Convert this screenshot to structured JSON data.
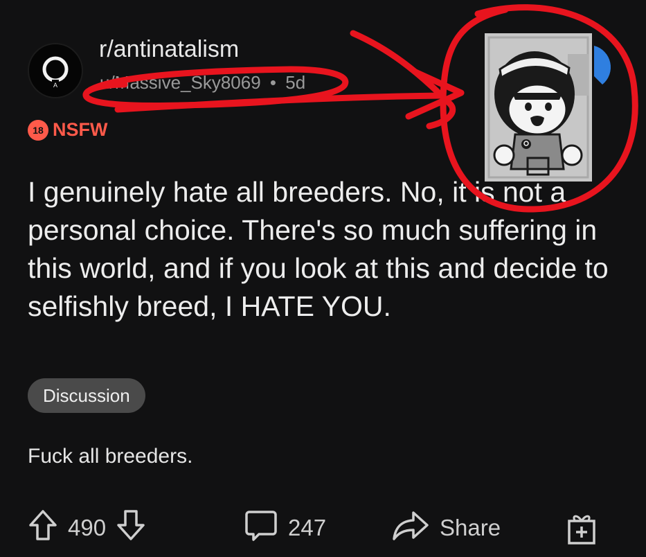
{
  "post": {
    "subreddit": "r/antinatalism",
    "author": "u/Massive_Sky8069",
    "separator": "•",
    "age": "5d",
    "nsfw_badge": "18",
    "nsfw_label": "NSFW",
    "title": "I genuinely hate all breeders. No, it is not a personal choice. There's so much suffering in this world, and if you look at this and decide to selfishly breed, I HATE YOU.",
    "flair": "Discussion",
    "body": "Fuck all breeders."
  },
  "actions": {
    "upvotes": "490",
    "comments": "247",
    "share_label": "Share"
  },
  "icons": {
    "subreddit_avatar": "antinatalism-logo-icon",
    "upvote": "arrow-up-icon",
    "downvote": "arrow-down-icon",
    "comment": "comment-bubble-icon",
    "share": "share-arrow-icon",
    "award": "gift-award-icon"
  },
  "colors": {
    "background": "#111112",
    "nsfw": "#ff5a4a",
    "annotation": "#e8141e",
    "flair_bg": "#4a4a4a",
    "accent_blue": "#2f7fe0"
  }
}
